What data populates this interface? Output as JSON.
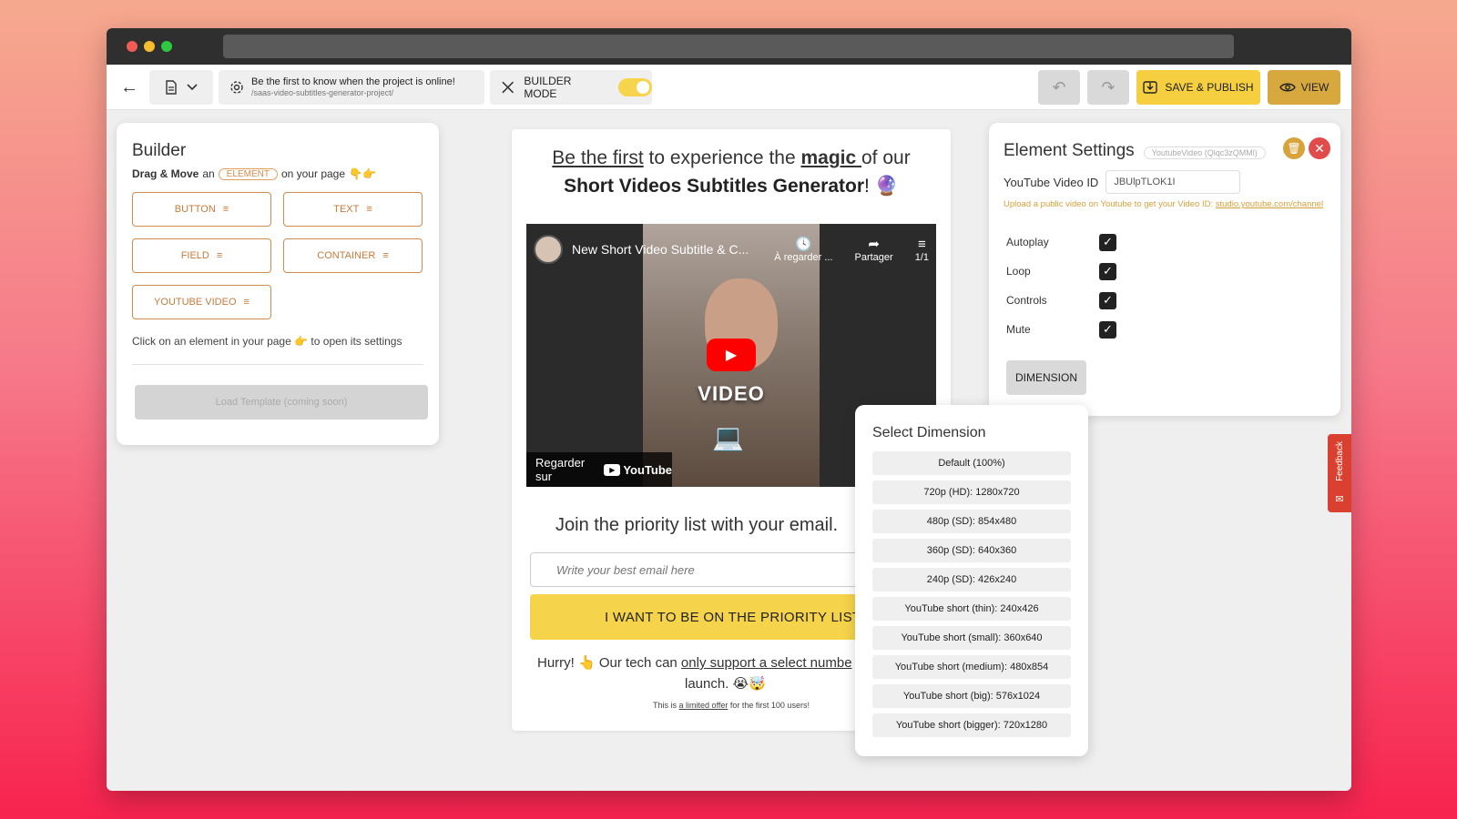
{
  "toolbar": {
    "project_title": "Be the first to know when the project is online!",
    "project_path": "/saas-video-subtitles-generator-project/",
    "builder_mode_label": "BUILDER MODE",
    "save_label": "SAVE & PUBLISH",
    "view_label": "VIEW"
  },
  "builder": {
    "title": "Builder",
    "drag_bold": "Drag & Move",
    "drag_an": "an",
    "element_pill": "ELEMENT",
    "drag_suffix": "on your page",
    "elements": [
      {
        "label": "BUTTON"
      },
      {
        "label": "TEXT"
      },
      {
        "label": "FIELD"
      },
      {
        "label": "CONTAINER"
      },
      {
        "label": "YOUTUBE VIDEO"
      }
    ],
    "hint_prefix": "Click on an element in your page",
    "hint_suffix": "to open its settings",
    "load_template": "Load Template (coming soon)"
  },
  "preview": {
    "hero_first": "Be the first",
    "hero_mid": " to experience the ",
    "hero_magic": "magic ",
    "hero_end": "of our",
    "hero_line2": "Short Videos Subtitles Generator",
    "hero_line2_end": "!",
    "video": {
      "title": "New Short Video Subtitle & C...",
      "watch_later": "À regarder ...",
      "share": "Partager",
      "playlist": "1/1",
      "overlay_word": "VIDEO",
      "watch_on": "Regarder sur",
      "yt_brand": "YouTube"
    },
    "join_text": "Join the priority list with your email.",
    "email_placeholder": "Write your best email here",
    "cta_label": "I WANT TO BE ON THE PRIORITY LIST",
    "hurry_prefix": "Hurry!",
    "hurry_mid": " Our tech can ",
    "hurry_link": "only support a select numbe",
    "hurry_line2": "launch.",
    "offer_prefix": "This is ",
    "offer_link": "a limited offer",
    "offer_suffix": " for the first 100 users!"
  },
  "settings": {
    "title": "Element Settings",
    "element_id": "YoutubeVideo (Qlqc3zQMMl)",
    "video_id_label": "YouTube Video ID",
    "video_id_value": "JBUlpTLOK1I",
    "help_prefix": "Upload a public video on Youtube to get your Video ID: ",
    "help_link": "studio.youtube.com/channel",
    "options": [
      {
        "label": "Autoplay",
        "checked": true
      },
      {
        "label": "Loop",
        "checked": true
      },
      {
        "label": "Controls",
        "checked": true
      },
      {
        "label": "Mute",
        "checked": true
      }
    ],
    "dimension_label": "DIMENSION"
  },
  "dimension_dropdown": {
    "title": "Select Dimension",
    "options": [
      "Default (100%)",
      "720p (HD): 1280x720",
      "480p (SD): 854x480",
      "360p (SD): 640x360",
      "240p (SD): 426x240",
      "YouTube short (thin): 240x426",
      "YouTube short (small): 360x640",
      "YouTube short (medium): 480x854",
      "YouTube short (big): 576x1024",
      "YouTube short (bigger): 720x1280"
    ]
  },
  "feedback": {
    "label": "Feedback"
  },
  "colors": {
    "accent_yellow": "#f5cf3f",
    "accent_gold": "#d7a83d",
    "accent_orange": "#d48a4c",
    "danger": "#e24b4b"
  }
}
